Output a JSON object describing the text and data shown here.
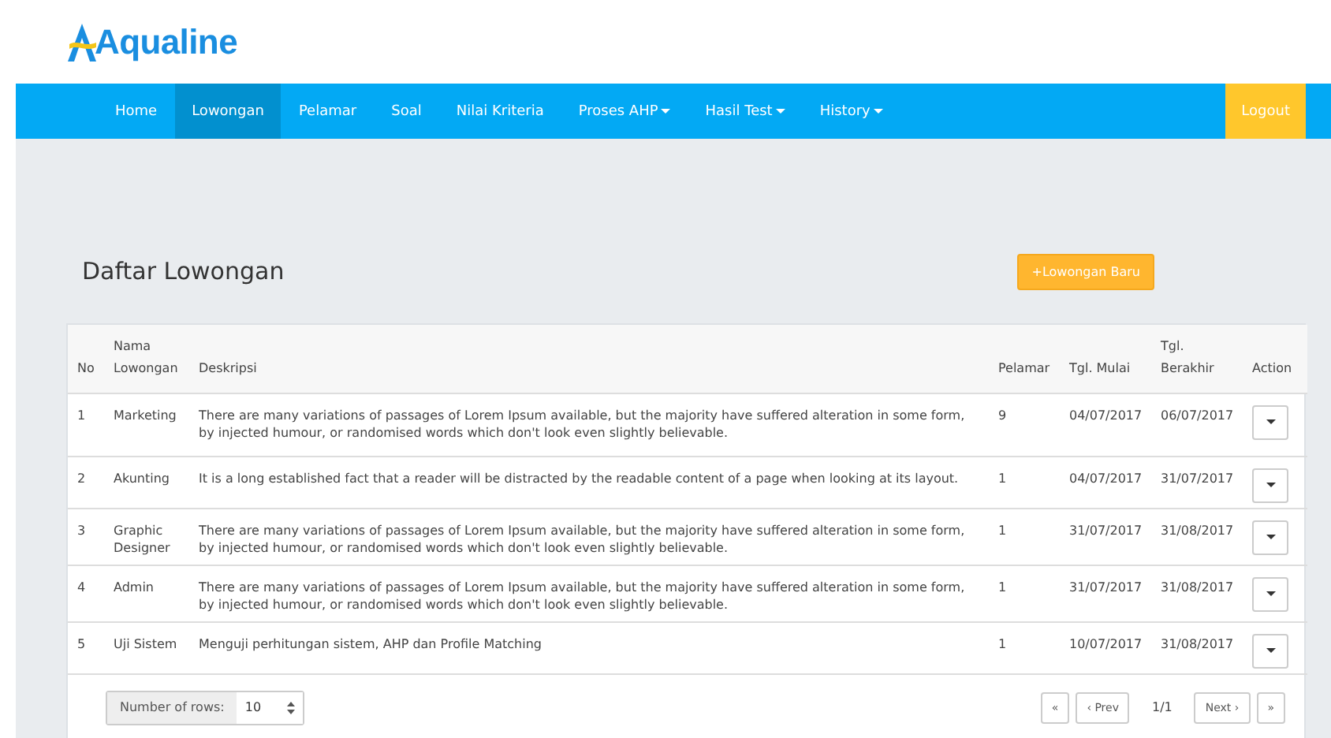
{
  "logo": {
    "text": "Aqualine"
  },
  "nav": {
    "items": [
      {
        "label": "Home",
        "selected": false,
        "dropdown": false
      },
      {
        "label": "Lowongan",
        "selected": true,
        "dropdown": false
      },
      {
        "label": "Pelamar",
        "selected": false,
        "dropdown": false
      },
      {
        "label": "Soal",
        "selected": false,
        "dropdown": false
      },
      {
        "label": "Nilai Kriteria",
        "selected": false,
        "dropdown": false
      },
      {
        "label": "Proses AHP",
        "selected": false,
        "dropdown": true
      },
      {
        "label": "Hasil Test",
        "selected": false,
        "dropdown": true
      },
      {
        "label": "History",
        "selected": false,
        "dropdown": true
      }
    ],
    "logout": "Logout"
  },
  "page": {
    "title": "Daftar Lowongan",
    "add_button": "+Lowongan Baru"
  },
  "table": {
    "columns": [
      [
        "No"
      ],
      [
        "Nama",
        "Lowongan"
      ],
      [
        "Deskripsi"
      ],
      [
        "Pelamar"
      ],
      [
        "Tgl. Mulai"
      ],
      [
        "Tgl.",
        "Berakhir"
      ],
      [
        "Action"
      ]
    ],
    "rows": [
      {
        "no": "1",
        "nama": "Marketing",
        "deskripsi": "There are many variations of passages of Lorem Ipsum available, but the majority have suffered alteration in some form, by injected humour, or randomised words which don't look even slightly believable.",
        "pelamar": "9",
        "mulai": "04/07/2017",
        "berakhir": "06/07/2017"
      },
      {
        "no": "2",
        "nama": "Akunting",
        "deskripsi": "It is a long established fact that a reader will be distracted by the readable content of a page when looking at its layout.",
        "pelamar": "1",
        "mulai": "04/07/2017",
        "berakhir": "31/07/2017"
      },
      {
        "no": "3",
        "nama": "Graphic Designer",
        "deskripsi": "There are many variations of passages of Lorem Ipsum available, but the majority have suffered alteration in some form, by injected humour, or randomised words which don't look even slightly believable.",
        "pelamar": "1",
        "mulai": "31/07/2017",
        "berakhir": "31/08/2017"
      },
      {
        "no": "4",
        "nama": "Admin",
        "deskripsi": "There are many variations of passages of Lorem Ipsum available, but the majority have suffered alteration in some form, by injected humour, or randomised words which don't look even slightly believable.",
        "pelamar": "1",
        "mulai": "31/07/2017",
        "berakhir": "31/08/2017"
      },
      {
        "no": "5",
        "nama": "Uji Sistem",
        "deskripsi": "Menguji perhitungan sistem, AHP dan Profile Matching",
        "pelamar": "1",
        "mulai": "10/07/2017",
        "berakhir": "31/08/2017"
      }
    ]
  },
  "footer": {
    "rows_label": "Number of rows:",
    "rows_value": "10",
    "first": "«",
    "prev": "‹ Prev",
    "page_info": "1/1",
    "next": "Next ›",
    "last": "»"
  }
}
